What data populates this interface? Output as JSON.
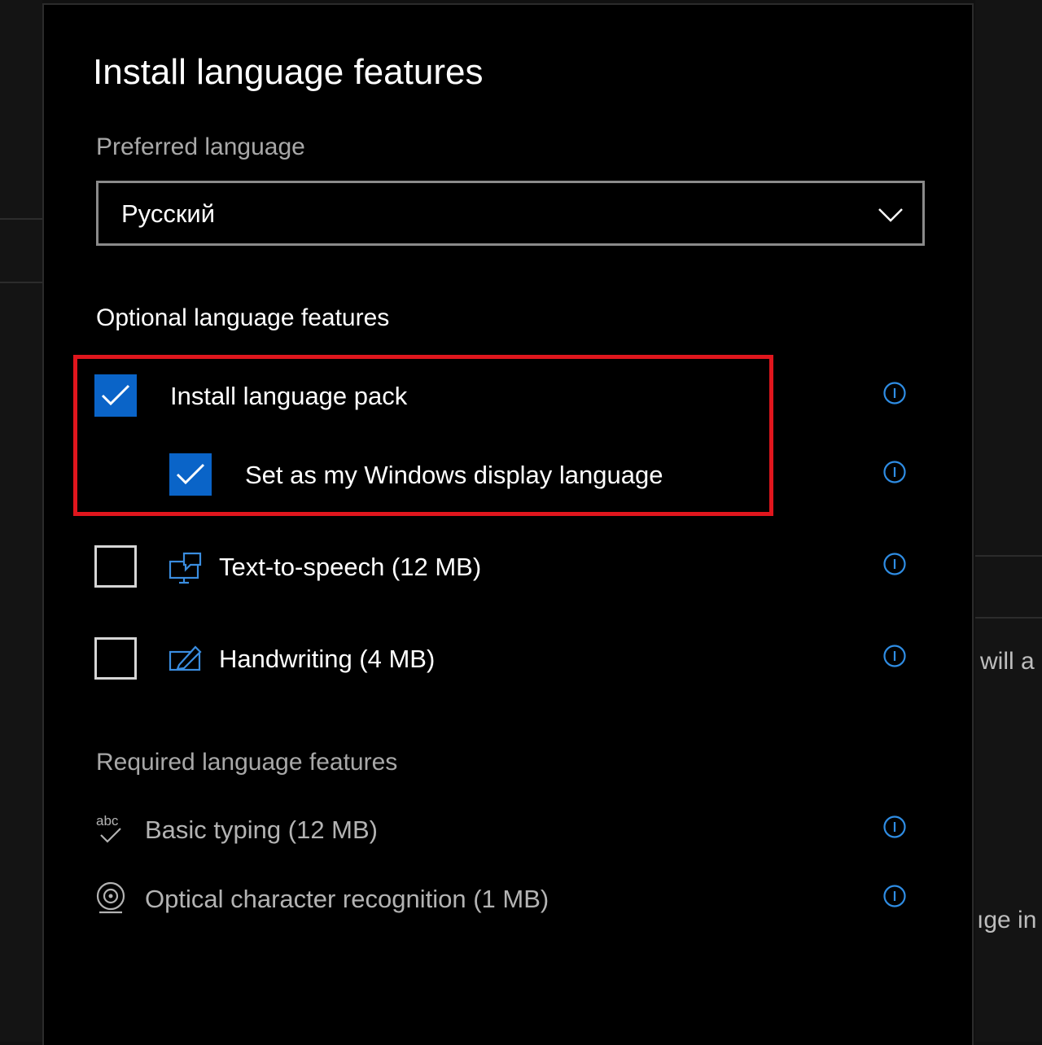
{
  "background": {
    "partial_text_right_1": "will a",
    "partial_text_right_2": "ıge in"
  },
  "dialog": {
    "title": "Install language features",
    "preferred_language_label": "Preferred language",
    "preferred_language_value": "Русский",
    "optional_section_label": "Optional language features",
    "optional_features": [
      {
        "label": "Install language pack",
        "checked": true,
        "icon": "none",
        "info_icon": "info-icon"
      },
      {
        "label": "Set as my Windows display language",
        "checked": true,
        "icon": "none",
        "info_icon": "info-icon"
      },
      {
        "label": "Text-to-speech (12 MB)",
        "checked": false,
        "icon": "speech-icon",
        "info_icon": "info-icon"
      },
      {
        "label": "Handwriting (4 MB)",
        "checked": false,
        "icon": "handwriting-icon",
        "info_icon": "info-icon"
      }
    ],
    "required_section_label": "Required language features",
    "required_features": [
      {
        "label": "Basic typing (12 MB)",
        "icon": "basic-typing-icon",
        "info_icon": "info-icon"
      },
      {
        "label": "Optical character recognition (1 MB)",
        "icon": "ocr-icon",
        "info_icon": "info-icon"
      }
    ]
  },
  "colors": {
    "accent": "#0a64c8",
    "highlight_box": "#e0161d",
    "dialog_bg": "#000000"
  }
}
